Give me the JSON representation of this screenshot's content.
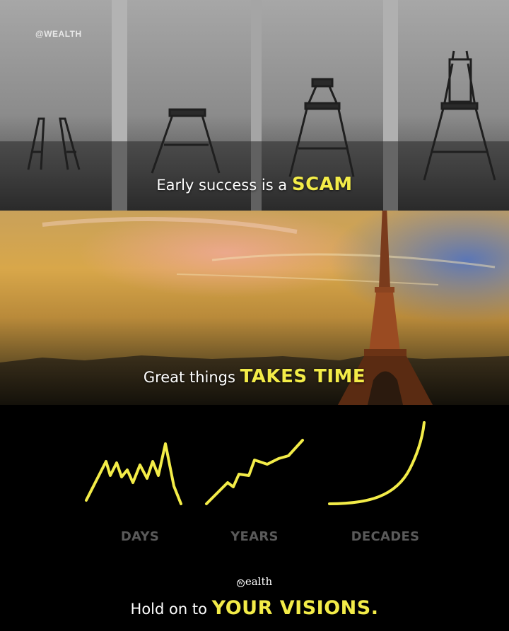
{
  "watermark": "@WEALTH",
  "top_caption": {
    "prefix": "Early success is a ",
    "highlight": "SCAM"
  },
  "middle_caption": {
    "prefix": "Great things ",
    "highlight": "TAKES TIME"
  },
  "graphs": [
    {
      "label": "DAYS",
      "icon": "volatile-line-icon"
    },
    {
      "label": "YEARS",
      "icon": "rising-line-icon"
    },
    {
      "label": "DECADES",
      "icon": "exponential-curve-icon"
    }
  ],
  "brand": {
    "text": "ealth",
    "mark": "w"
  },
  "bottom_caption": {
    "prefix": "Hold on to ",
    "highlight": "YOUR VISIONS."
  },
  "colors": {
    "highlight": "#f3ec48",
    "graph_line": "#f3ec48",
    "label_gray": "#5a5a5a",
    "background": "#000000"
  }
}
